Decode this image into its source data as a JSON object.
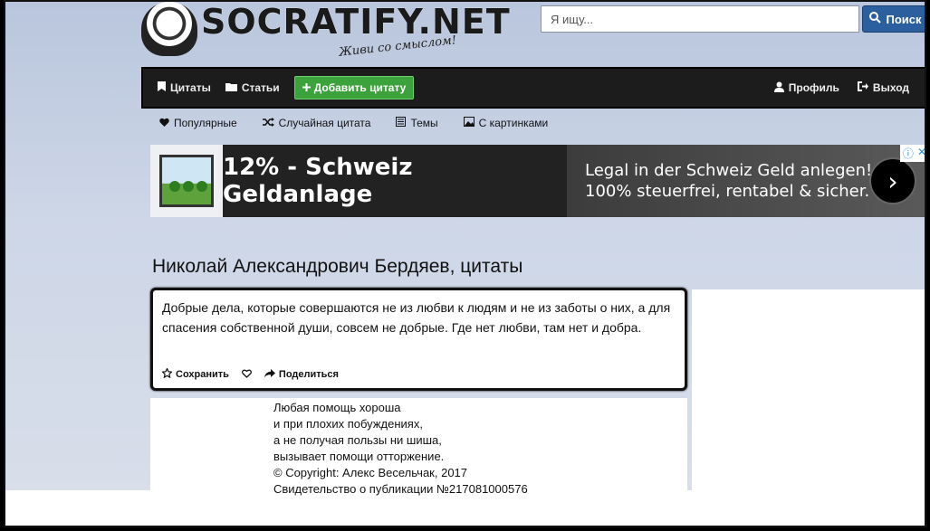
{
  "header": {
    "logo_text": "SOCRATIFY.NET",
    "logo_slogan": "Живи со смыслом!",
    "search_placeholder": "Я ищу...",
    "search_button": "Поиск"
  },
  "navbar": {
    "quotes": "Цитаты",
    "articles": "Статьи",
    "add_quote": "Добавить цитату",
    "profile": "Профиль",
    "logout": "Выход"
  },
  "subnav": {
    "popular": "Популярные",
    "random": "Случайная цитата",
    "topics": "Темы",
    "with_pictures": "С картинками"
  },
  "ad": {
    "headline": "12% - Schweiz Geldanlage",
    "line1": "Legal in der Schweiz Geld anlegen!",
    "line2": "100% steuerfrei, rentabel & sicher.",
    "arrow": "›"
  },
  "page_title": "Николай Александрович Бердяев, цитаты",
  "quote": {
    "text": "Добрые дела, которые совершаются не из любви к людям и не из заботы о них, а для спасения собственной души, совсем не добрые. Где нет любви, там нет и добра.",
    "save": "Сохранить",
    "share": "Поделиться"
  },
  "poem": [
    "Любая помощь хороша",
    "и при плохих побуждениях,",
    "а не получая пользы ни шиша,",
    "вызывает помощи отторжение.",
    "© Copyright: Алекс Весельчак, 2017",
    "Свидетельство о публикации №217081000576"
  ],
  "colors": {
    "navbar": "#1c1c1c",
    "add_button": "#3ca33c",
    "search_button": "#2b5f9e"
  }
}
